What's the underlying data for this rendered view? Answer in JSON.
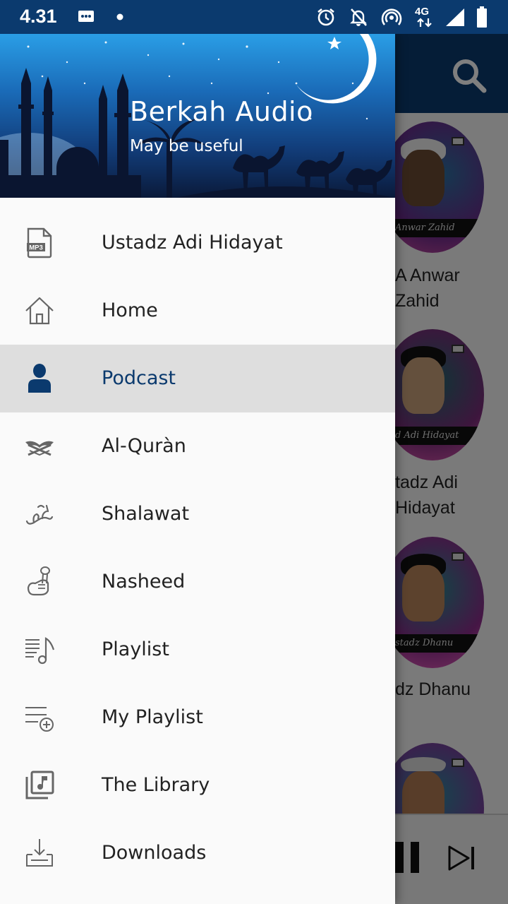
{
  "status_bar": {
    "time": "4.31",
    "icons": [
      "message-icon",
      "dot-icon",
      "alarm-icon",
      "notifications-off-icon",
      "hotspot-icon",
      "4g-icon",
      "signal-icon",
      "battery-icon"
    ],
    "network_label": "4G"
  },
  "colors": {
    "primary": "#0b3a6e",
    "active_item_bg": "#dedede",
    "drawer_bg": "#fafafa"
  },
  "drawer": {
    "title": "Berkah Audio",
    "subtitle": "May be useful",
    "items": [
      {
        "label": "Ustadz Adi Hidayat",
        "icon": "mp3-file-icon",
        "active": false
      },
      {
        "label": "Home",
        "icon": "home-icon",
        "active": false
      },
      {
        "label": "Podcast",
        "icon": "person-icon",
        "active": true
      },
      {
        "label": "Al-Quràn",
        "icon": "quran-icon",
        "active": false
      },
      {
        "label": "Shalawat",
        "icon": "muhammad-calligraphy-icon",
        "active": false
      },
      {
        "label": "Nasheed",
        "icon": "microphone-hand-icon",
        "active": false
      },
      {
        "label": "Playlist",
        "icon": "playlist-music-icon",
        "active": false
      },
      {
        "label": "My Playlist",
        "icon": "playlist-add-icon",
        "active": false
      },
      {
        "label": "The Library",
        "icon": "music-library-icon",
        "active": false
      },
      {
        "label": "Downloads",
        "icon": "download-icon",
        "active": false
      }
    ]
  },
  "background": {
    "cards": [
      {
        "label": "A Anwar\nZahid",
        "banner": "Anwar Zahid"
      },
      {
        "label": "tadz Adi\nHidayat",
        "banner": "d Adi Hidayat"
      },
      {
        "label": "dz Dhanu",
        "banner": "stadz Dhanu"
      }
    ]
  }
}
